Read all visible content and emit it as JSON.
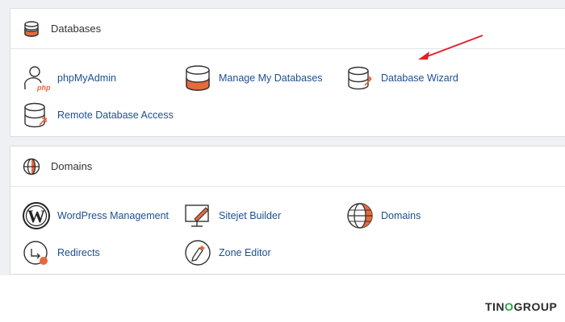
{
  "sections": {
    "databases": {
      "title": "Databases",
      "items": [
        {
          "label": "phpMyAdmin",
          "icon": "phpmyadmin-icon"
        },
        {
          "label": "Manage My Databases",
          "icon": "database-icon"
        },
        {
          "label": "Database Wizard",
          "icon": "database-wizard-icon"
        },
        {
          "label": "Remote Database Access",
          "icon": "remote-database-icon"
        }
      ]
    },
    "domains": {
      "title": "Domains",
      "items": [
        {
          "label": "WordPress Management",
          "icon": "wordpress-icon"
        },
        {
          "label": "Sitejet Builder",
          "icon": "sitejet-icon"
        },
        {
          "label": "Domains",
          "icon": "globe-icon"
        },
        {
          "label": "Redirects",
          "icon": "redirect-icon"
        },
        {
          "label": "Zone Editor",
          "icon": "zone-editor-icon"
        }
      ]
    }
  },
  "watermark": {
    "part1": "TIN",
    "part2": "O",
    "part3": "GROUP"
  },
  "colors": {
    "accent": "#e8693a",
    "link": "#1d4f91",
    "arrow": "#e0202a",
    "watermark_o": "#2aa24b"
  }
}
